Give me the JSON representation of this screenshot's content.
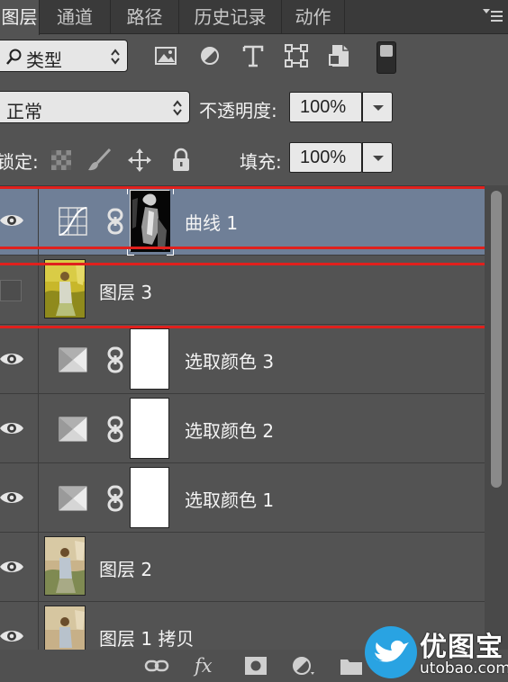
{
  "tabs": [
    {
      "label": "图层",
      "active": true
    },
    {
      "label": "通道",
      "active": false
    },
    {
      "label": "路径",
      "active": false
    },
    {
      "label": "历史记录",
      "active": false
    },
    {
      "label": "动作",
      "active": false
    }
  ],
  "filter": {
    "kind_label": "类型",
    "filter_icons": [
      "image-filter-icon",
      "adjustment-filter-icon",
      "type-filter-icon",
      "shape-filter-icon",
      "smart-object-filter-icon"
    ]
  },
  "blend": {
    "mode": "正常",
    "opacity_label": "不透明度:",
    "opacity_value": "100%"
  },
  "lock": {
    "label": "锁定:",
    "icons": [
      "lock-transparent-icon",
      "lock-image-icon",
      "lock-position-icon",
      "lock-all-icon"
    ],
    "fill_label": "填充:",
    "fill_value": "100%"
  },
  "layers": [
    {
      "name": "曲线 1",
      "type": "curves",
      "visible": true,
      "selected": true,
      "highlighted": true
    },
    {
      "name": "图层 3",
      "type": "pixel",
      "visible": false,
      "selected": false,
      "highlighted": true
    },
    {
      "name": "选取颜色 3",
      "type": "selective-color",
      "visible": true,
      "selected": false,
      "highlighted": false
    },
    {
      "name": "选取颜色 2",
      "type": "selective-color",
      "visible": true,
      "selected": false,
      "highlighted": false
    },
    {
      "name": "选取颜色 1",
      "type": "selective-color",
      "visible": true,
      "selected": false,
      "highlighted": false
    },
    {
      "name": "图层 2",
      "type": "pixel",
      "visible": true,
      "selected": false,
      "highlighted": false
    },
    {
      "name": "图层 1 拷贝",
      "type": "pixel",
      "visible": true,
      "selected": false,
      "highlighted": false
    }
  ],
  "bottom_icons": [
    "link-layers-icon",
    "fx-icon",
    "add-mask-icon",
    "new-adjustment-icon",
    "new-group-icon"
  ],
  "bottom_fx_label": "fx",
  "watermark": {
    "name": "优图宝",
    "url": "utobao.com"
  },
  "colors": {
    "highlight": "#e0201d",
    "selected": "#6f7f97",
    "panel": "#535353"
  }
}
